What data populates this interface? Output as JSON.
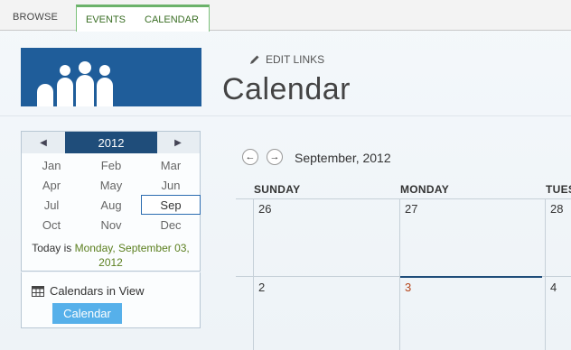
{
  "ribbon": {
    "browse": "BROWSE",
    "events": "EVENTS",
    "calendar": "CALENDAR"
  },
  "header": {
    "edit_links": "EDIT LINKS",
    "title": "Calendar"
  },
  "date_picker": {
    "year": "2012",
    "months": [
      "Jan",
      "Feb",
      "Mar",
      "Apr",
      "May",
      "Jun",
      "Jul",
      "Aug",
      "Sep",
      "Oct",
      "Nov",
      "Dec"
    ],
    "selected_month": "Sep",
    "today_prefix": "Today is ",
    "today_date": "Monday, September 03, 2012"
  },
  "calendars_in_view": {
    "title": "Calendars in View",
    "button": "Calendar"
  },
  "calendar": {
    "month_label": "September, 2012",
    "day_names": [
      "SUNDAY",
      "MONDAY",
      "TUES"
    ],
    "week1": [
      "26",
      "27",
      "28"
    ],
    "week2": [
      "2",
      "3",
      "4"
    ]
  },
  "colors": {
    "accent_blue": "#1f5d9a",
    "selected_blue": "#56b0ea",
    "today_green": "#5b7f1f",
    "today_number": "#b5451b"
  }
}
